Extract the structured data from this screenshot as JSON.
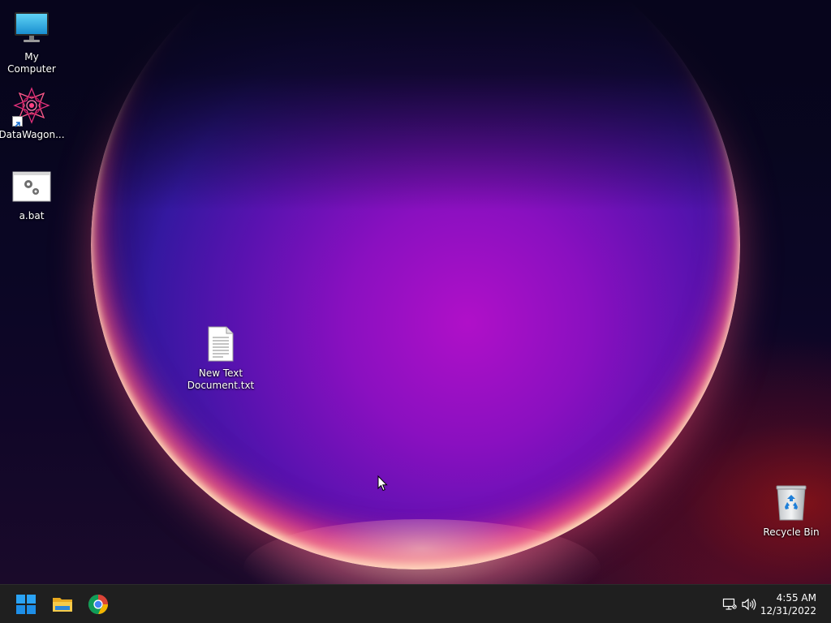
{
  "desktop": {
    "icons": [
      {
        "label": "My Computer",
        "icon": "monitor-icon"
      },
      {
        "label": "DataWagon...",
        "icon": "datawagon-app-icon"
      },
      {
        "label": "a.bat",
        "icon": "batch-file-icon"
      },
      {
        "label": "New Text\nDocument.txt",
        "icon": "text-file-icon"
      },
      {
        "label": "Recycle Bin",
        "icon": "recycle-bin-icon"
      }
    ]
  },
  "taskbar": {
    "apps": [
      {
        "name": "Start",
        "icon": "windows-start-icon"
      },
      {
        "name": "File Explorer",
        "icon": "folder-icon"
      },
      {
        "name": "Google Chrome",
        "icon": "chrome-icon"
      }
    ],
    "tray": {
      "network_icon": "network-icon",
      "volume_icon": "volume-icon",
      "time": "4:55 AM",
      "date": "12/31/2022"
    }
  },
  "colors": {
    "taskbar_bg": "#1f1f1f",
    "windows_blue": "#1e90ff",
    "folder_yellow": "#f3c33e"
  }
}
